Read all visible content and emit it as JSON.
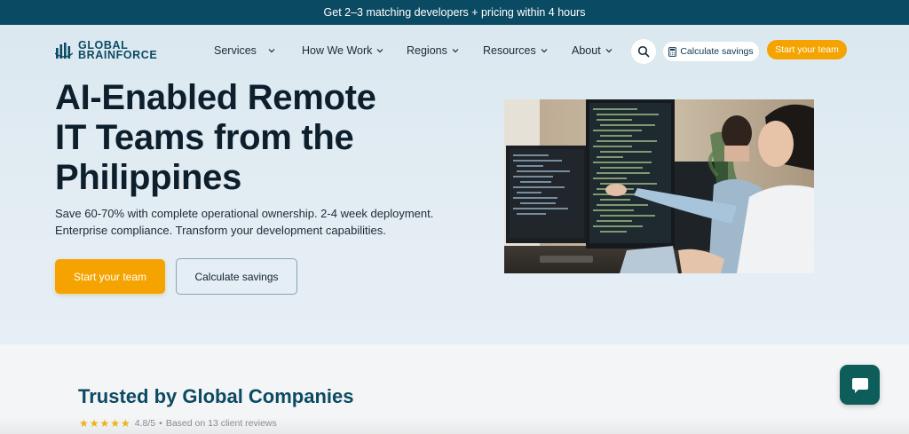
{
  "announcement": "Get 2–3 matching developers + pricing within 4 hours",
  "logo": {
    "line1": "GLOBAL",
    "line2": "BRAINFORCE",
    "icon": "logo-bars-icon"
  },
  "nav": {
    "items": [
      {
        "label": "Services"
      },
      {
        "label": "How We Work"
      },
      {
        "label": "Regions"
      },
      {
        "label": "Resources"
      },
      {
        "label": "About"
      }
    ],
    "search_icon": "search-icon",
    "calc_label": "Calculate savings",
    "calc_icon": "calculator-icon",
    "start_label": "Start your team"
  },
  "hero": {
    "headline": [
      "AI-Enabled Remote",
      "IT Teams from the",
      "Philippines"
    ],
    "subtext": [
      "Save 60-70% with complete operational ownership. 2-4 week deployment.",
      "Enterprise compliance. Transform your development capabilities."
    ],
    "cta_primary": "Start your team",
    "cta_secondary": "Calculate savings"
  },
  "trusted": {
    "title": "Trusted by Global Companies",
    "stars": "★★★★★",
    "rating": "4.8/5",
    "separator": "•",
    "reviews": "Based on 13 client reviews"
  },
  "colors": {
    "topbar": "#0b4a63",
    "accent": "#f5a300",
    "brand": "#0b4a63",
    "chat": "#0d5d5a"
  }
}
